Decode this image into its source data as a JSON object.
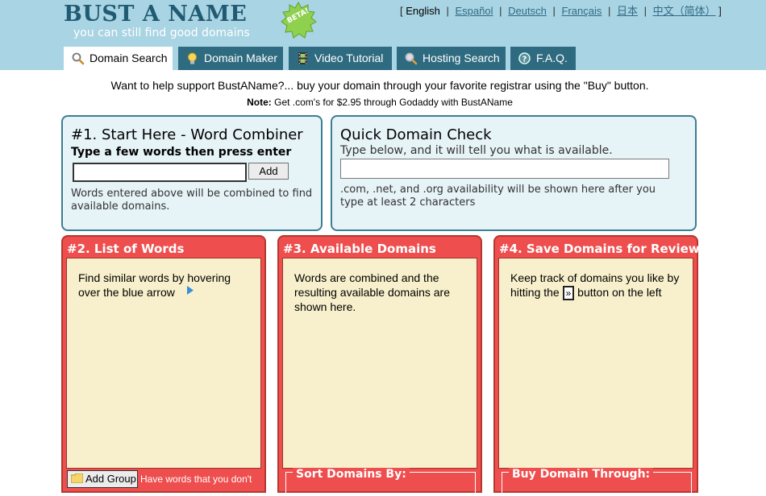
{
  "header": {
    "logo_title": "BUST A NAME",
    "logo_badge": "BETA!",
    "logo_tagline": "you can still find good domains",
    "languages": [
      {
        "label": "English",
        "current": true
      },
      {
        "label": "Español",
        "current": false
      },
      {
        "label": "Deutsch",
        "current": false
      },
      {
        "label": "Français",
        "current": false
      },
      {
        "label": "日本",
        "current": false
      },
      {
        "label": "中文（简体）",
        "current": false
      }
    ]
  },
  "tabs": [
    {
      "label": "Domain Search",
      "icon": "magnifier-icon",
      "active": true
    },
    {
      "label": "Domain Maker",
      "icon": "lightbulb-icon",
      "active": false
    },
    {
      "label": "Video Tutorial",
      "icon": "film-icon",
      "active": false
    },
    {
      "label": "Hosting Search",
      "icon": "magnifier-icon",
      "active": false
    },
    {
      "label": "F.A.Q.",
      "icon": "help-icon",
      "active": false
    }
  ],
  "support": {
    "message": "Want to help support BustAName?... buy your domain through your favorite registrar using the \"Buy\" button.",
    "note_label": "Note:",
    "note_text": " Get .com's for $2.95 through Godaddy with BustAName"
  },
  "word_combiner": {
    "title": "#1. Start Here - Word Combiner",
    "subtitle": "Type a few words then press enter",
    "input_value": "",
    "add_label": "Add",
    "help": "Words entered above will be combined to find available domains."
  },
  "quick_check": {
    "title": "Quick Domain Check",
    "subtitle": "Type below, and it will tell you what is available.",
    "input_value": "",
    "help": ".com, .net, and .org availability will be shown here after you type at least 2 characters"
  },
  "list_of_words": {
    "title": "#2. List of Words",
    "text": "Find similar words by hovering over the blue arrow",
    "add_group_label": "Add Group",
    "add_group_text": "Have words that you don't"
  },
  "available_domains": {
    "title": "#3. Available Domains",
    "text": "Words are combined and the resulting available domains are shown here.",
    "sort_label": "Sort Domains By:"
  },
  "save_domains": {
    "title": "#4. Save Domains for Review",
    "text_before": "Keep track of domains you like by hitting the ",
    "button_glyph": "»",
    "text_after": " button on the left",
    "buy_label": "Buy Domain Through:"
  },
  "colors": {
    "header_bg": "#a9d4e3",
    "tab_bg": "#2f6b80",
    "panel_blue_bg": "#e6f3f7",
    "panel_blue_border": "#3c7e94",
    "panel_red": "#ee4e4e",
    "cream": "#f8f0cc",
    "badge_green": "#8fd14f"
  }
}
